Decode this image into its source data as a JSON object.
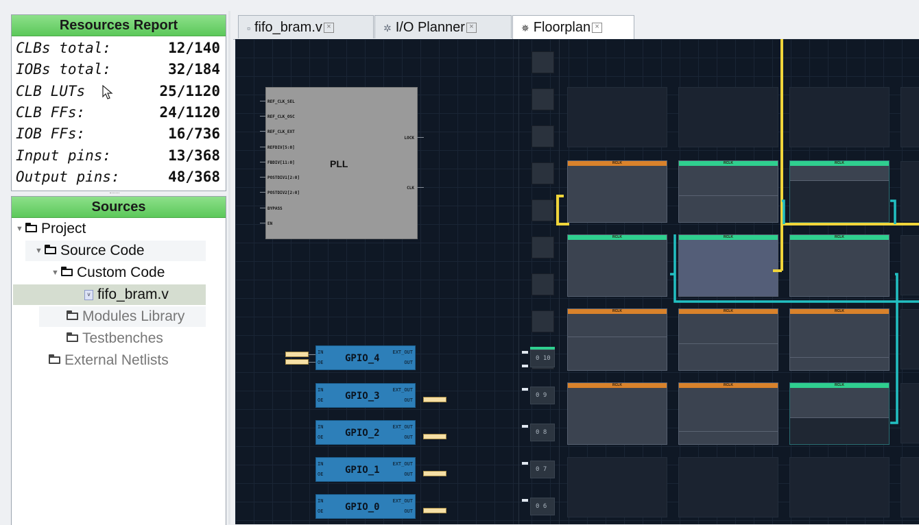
{
  "resources": {
    "title": "Resources Report",
    "rows": [
      {
        "label": "CLBs total:",
        "value": "12/140"
      },
      {
        "label": "IOBs total:",
        "value": "32/184"
      },
      {
        "label": "CLB LUTs",
        "value": "25/1120"
      },
      {
        "label": "CLB FFs:",
        "value": "24/1120"
      },
      {
        "label": "IOB FFs:",
        "value": "16/736"
      },
      {
        "label": "Input pins:",
        "value": "13/368"
      },
      {
        "label": "Output pins:",
        "value": "48/368"
      }
    ]
  },
  "sources": {
    "title": "Sources",
    "tree": [
      {
        "label": "Project"
      },
      {
        "label": "Source Code"
      },
      {
        "label": "Custom Code"
      },
      {
        "label": "fifo_bram.v"
      },
      {
        "label": "Modules Library"
      },
      {
        "label": "Testbenches"
      },
      {
        "label": "External Netlists"
      }
    ]
  },
  "tabs": [
    {
      "label": "fifo_bram.v",
      "icon": "verilog-file-icon"
    },
    {
      "label": "I/O Planner",
      "icon": "chip-icon"
    },
    {
      "label": "Floorplan",
      "icon": "gear-chip-icon",
      "active": true
    }
  ],
  "pll": {
    "title": "PLL",
    "inputs": [
      "REF_CLK_SEL",
      "REF_CLK_OSC",
      "REF_CLK_EXT",
      "REFDIV[5:0]",
      "FBDIV[11:0]",
      "POSTDIV1[2:0]",
      "POSTDIV2[2:0]",
      "BYPASS",
      "EN"
    ],
    "outputs": [
      "LOCK",
      "CLK"
    ]
  },
  "gpio": [
    {
      "name": "GPIO_4",
      "in": "IN",
      "oe": "OE",
      "ext_out": "EXT_OUT",
      "out": "OUT"
    },
    {
      "name": "GPIO_3",
      "in": "IN",
      "oe": "OE",
      "ext_out": "EXT_OUT",
      "out": "OUT"
    },
    {
      "name": "GPIO_2",
      "in": "IN",
      "oe": "OE",
      "ext_out": "EXT_OUT",
      "out": "OUT"
    },
    {
      "name": "GPIO_1",
      "in": "IN",
      "oe": "OE",
      "ext_out": "EXT_OUT",
      "out": "OUT"
    },
    {
      "name": "GPIO_0",
      "in": "IN",
      "oe": "OE",
      "ext_out": "EXT_OUT",
      "out": "OUT"
    }
  ],
  "io_cells": [
    "0 10",
    "0 9",
    "0 8",
    "0 7",
    "0 6"
  ],
  "block_label": "RCLK",
  "colors": {
    "header_green": "#5cc85a",
    "canvas_bg": "#0f1825",
    "gpio_blue": "#2d7fb9",
    "wire_yellow": "#f0d53a",
    "wire_teal": "#22bfc2",
    "bar_orange": "#d9822b",
    "bar_green": "#2fcf8f"
  }
}
